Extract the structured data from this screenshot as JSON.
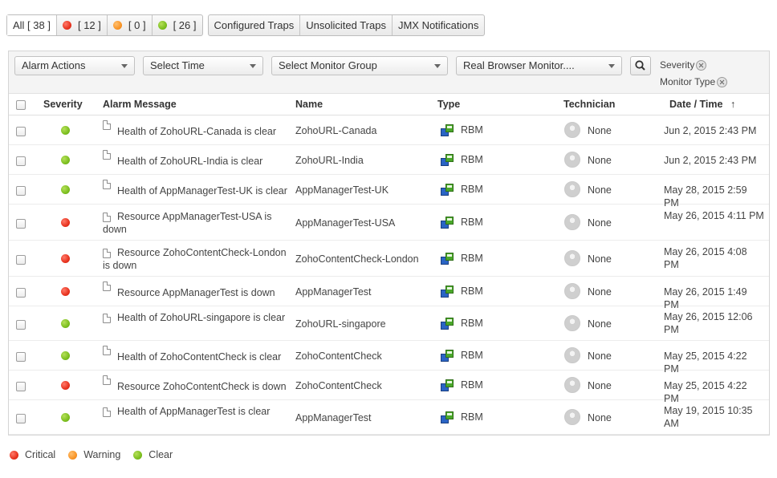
{
  "tabs": {
    "severity_tabs": [
      {
        "label": "All [ 38 ]",
        "dot": null
      },
      {
        "label": "[ 12 ]",
        "dot": "critical"
      },
      {
        "label": "[ 0 ]",
        "dot": "warning"
      },
      {
        "label": "[ 26 ]",
        "dot": "clear"
      }
    ],
    "type_tabs": [
      "Configured Traps",
      "Unsolicited Traps",
      "JMX Notifications"
    ]
  },
  "toolbar": {
    "alarm_actions": "Alarm Actions",
    "select_time": "Select Time",
    "select_monitor_group": "Select Monitor Group",
    "monitor_type": "Real Browser Monitor....",
    "filter_severity": "Severity",
    "filter_monitor_type": "Monitor Type"
  },
  "columns": {
    "severity": "Severity",
    "alarm_message": "Alarm Message",
    "name": "Name",
    "type": "Type",
    "technician": "Technician",
    "date_time": "Date / Time",
    "sort_indicator": "↑"
  },
  "rows": [
    {
      "severity": "clear",
      "message": "Health of ZohoURL-Canada is clear",
      "name": "ZohoURL-Canada",
      "type": "RBM",
      "technician": "None",
      "date": "Jun 2, 2015 2:43 PM"
    },
    {
      "severity": "clear",
      "message": "Health of ZohoURL-India is clear",
      "name": "ZohoURL-India",
      "type": "RBM",
      "technician": "None",
      "date": "Jun 2, 2015 2:43 PM"
    },
    {
      "severity": "clear",
      "message": "Health of AppManagerTest-UK is clear",
      "name": "AppManagerTest-UK",
      "type": "RBM",
      "technician": "None",
      "date": "May 28, 2015 2:59 PM"
    },
    {
      "severity": "critical",
      "message": "Resource AppManagerTest-USA is down",
      "name": "AppManagerTest-USA",
      "type": "RBM",
      "technician": "None",
      "date": "May 26, 2015 4:11 PM"
    },
    {
      "severity": "critical",
      "message": "Resource ZohoContentCheck-London is down",
      "name": "ZohoContentCheck-London",
      "type": "RBM",
      "technician": "None",
      "date": "May 26, 2015 4:08 PM"
    },
    {
      "severity": "critical",
      "message": "Resource AppManagerTest is down",
      "name": "AppManagerTest",
      "type": "RBM",
      "technician": "None",
      "date": "May 26, 2015 1:49 PM"
    },
    {
      "severity": "clear",
      "message": "Health of ZohoURL-singapore is clear",
      "name": "ZohoURL-singapore",
      "type": "RBM",
      "technician": "None",
      "date": "May 26, 2015 12:06 PM"
    },
    {
      "severity": "clear",
      "message": "Health of ZohoContentCheck is clear",
      "name": "ZohoContentCheck",
      "type": "RBM",
      "technician": "None",
      "date": "May 25, 2015 4:22 PM"
    },
    {
      "severity": "critical",
      "message": "Resource ZohoContentCheck is down",
      "name": "ZohoContentCheck",
      "type": "RBM",
      "technician": "None",
      "date": "May 25, 2015 4:22 PM"
    },
    {
      "severity": "clear",
      "message": "Health of AppManagerTest is clear",
      "name": "AppManagerTest",
      "type": "RBM",
      "technician": "None",
      "date": "May 19, 2015 10:35 AM"
    }
  ],
  "legend": [
    {
      "label": "Critical",
      "dot": "critical"
    },
    {
      "label": "Warning",
      "dot": "warning"
    },
    {
      "label": "Clear",
      "dot": "clear"
    }
  ],
  "colors": {
    "critical": "#e8331f",
    "warning": "#f99527",
    "clear": "#7cbf1f"
  }
}
